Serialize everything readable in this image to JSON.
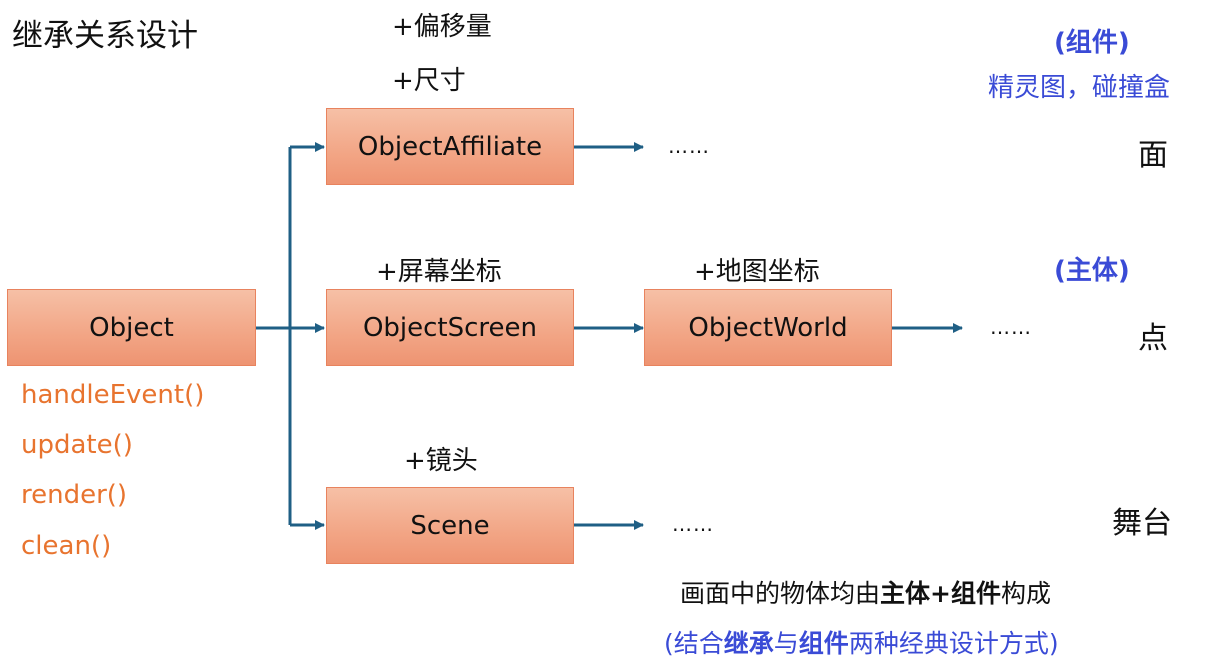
{
  "title": "继承关系设计",
  "boxes": {
    "object": "Object",
    "affiliate": "ObjectAffiliate",
    "screen": "ObjectScreen",
    "world": "ObjectWorld",
    "scene": "Scene"
  },
  "methods": [
    "handleEvent()",
    "update()",
    "render()",
    "clean()"
  ],
  "notes": {
    "offset": "+偏移量",
    "size": "+尺寸",
    "screen_coord": "+屏幕坐标",
    "map_coord": "+地图坐标",
    "camera": "+镜头"
  },
  "ellipsis": "……",
  "right": {
    "component_tag": "(组件)",
    "component_desc": "精灵图，碰撞盒",
    "surface": "面",
    "main_tag": "(主体)",
    "point": "点",
    "stage": "舞台"
  },
  "summary": {
    "line1_a": "画面中的物体均由",
    "line1_b": "主体+组件",
    "line1_c": "构成",
    "line2_a": "(结合",
    "line2_b": "继承",
    "line2_c": "与",
    "line2_d": "组件",
    "line2_e": "两种经典设计方式)"
  },
  "colors": {
    "arrow": "#1f5f85",
    "box_fill": "#f2a585",
    "method_text": "#e8742f",
    "accent_blue": "#3a4bd6"
  }
}
